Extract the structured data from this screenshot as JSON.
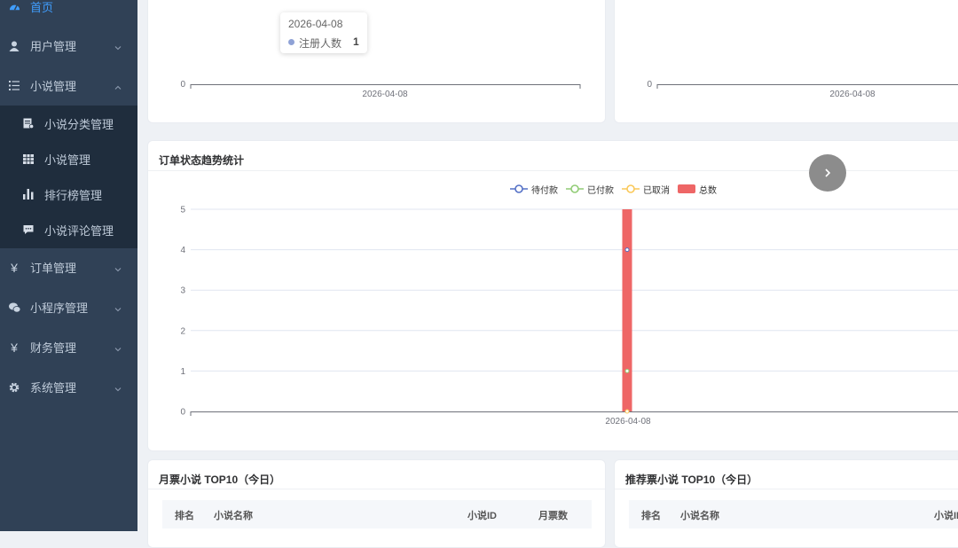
{
  "sidebar": {
    "home": {
      "label": "首页",
      "icon": "dashboard-icon"
    },
    "user_mgmt": {
      "label": "用户管理",
      "icon": "user-icon"
    },
    "novel_mgmt": {
      "label": "小说管理",
      "icon": "list-icon"
    },
    "novel_sub": [
      {
        "label": "小说分类管理",
        "icon": "category-icon"
      },
      {
        "label": "小说管理",
        "icon": "grid-icon"
      },
      {
        "label": "排行榜管理",
        "icon": "bar-chart-icon"
      },
      {
        "label": "小说评论管理",
        "icon": "comment-icon"
      }
    ],
    "order_mgmt": {
      "label": "订单管理",
      "icon": "yen-icon"
    },
    "mini_mgmt": {
      "label": "小程序管理",
      "icon": "wechat-icon"
    },
    "finance_mgmt": {
      "label": "财务管理",
      "icon": "yen-icon"
    },
    "system_mgmt": {
      "label": "系统管理",
      "icon": "gear-icon"
    }
  },
  "top_left_chart": {
    "tooltip": {
      "date": "2026-04-08",
      "series": "注册人数",
      "value": "1"
    },
    "y_tick": "0",
    "x_tick": "2026-04-08"
  },
  "top_right_chart": {
    "y_tick": "0",
    "x_tick": "2026-04-08"
  },
  "order_trend": {
    "title": "订单状态趋势统计",
    "next_icon": "chevron-right-icon"
  },
  "chart_data": {
    "type": "bar",
    "title": "订单状态趋势统计",
    "categories": [
      "2026-04-08"
    ],
    "ylim": [
      0,
      5
    ],
    "y_ticks": [
      "0",
      "1",
      "2",
      "3",
      "4",
      "5"
    ],
    "grid": true,
    "legend": "top-center",
    "series": [
      {
        "name": "待付款",
        "kind": "line",
        "color": "#5470c6",
        "values": [
          4
        ]
      },
      {
        "name": "已付款",
        "kind": "line",
        "color": "#91cc75",
        "values": [
          1
        ]
      },
      {
        "name": "已取消",
        "kind": "line",
        "color": "#fac858",
        "values": [
          0
        ]
      },
      {
        "name": "总数",
        "kind": "bar",
        "color": "#ee6666",
        "values": [
          5
        ]
      }
    ]
  },
  "monthly_top10": {
    "title": "月票小说 TOP10（今日）",
    "columns": [
      "排名",
      "小说名称",
      "小说ID",
      "月票数"
    ]
  },
  "recommend_top10": {
    "title": "推荐票小说 TOP10（今日）",
    "columns": [
      "排名",
      "小说名称",
      "小说ID"
    ]
  }
}
